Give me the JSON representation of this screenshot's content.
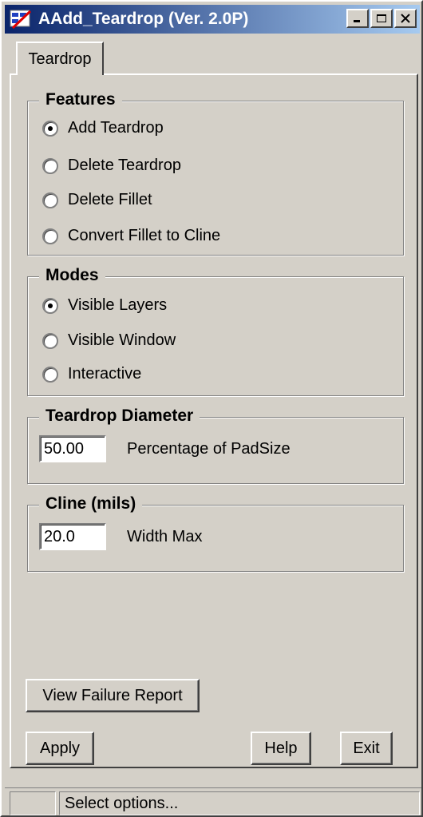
{
  "window": {
    "title": "AAdd_Teardrop (Ver. 2.0P)",
    "controls": {
      "minimize": "minimize-icon",
      "maximize": "maximize-icon",
      "close": "close-icon"
    }
  },
  "tab": {
    "label": "Teardrop"
  },
  "features": {
    "title": "Features",
    "options": [
      {
        "label": "Add Teardrop",
        "checked": true
      },
      {
        "label": "Delete Teardrop",
        "checked": false
      },
      {
        "label": "Delete Fillet",
        "checked": false
      },
      {
        "label": "Convert Fillet to Cline",
        "checked": false
      }
    ]
  },
  "modes": {
    "title": "Modes",
    "options": [
      {
        "label": "Visible Layers",
        "checked": true
      },
      {
        "label": "Visible Window",
        "checked": false
      },
      {
        "label": "Interactive",
        "checked": false
      }
    ]
  },
  "teardrop_diameter": {
    "title": "Teardrop Diameter",
    "value": "50.00",
    "label": "Percentage of PadSize"
  },
  "cline": {
    "title": "Cline (mils)",
    "value": "20.0",
    "label": "Width Max"
  },
  "buttons": {
    "view_failure_report": "View Failure Report",
    "apply": "Apply",
    "help": "Help",
    "exit": "Exit"
  },
  "status": {
    "text": "Select options..."
  }
}
